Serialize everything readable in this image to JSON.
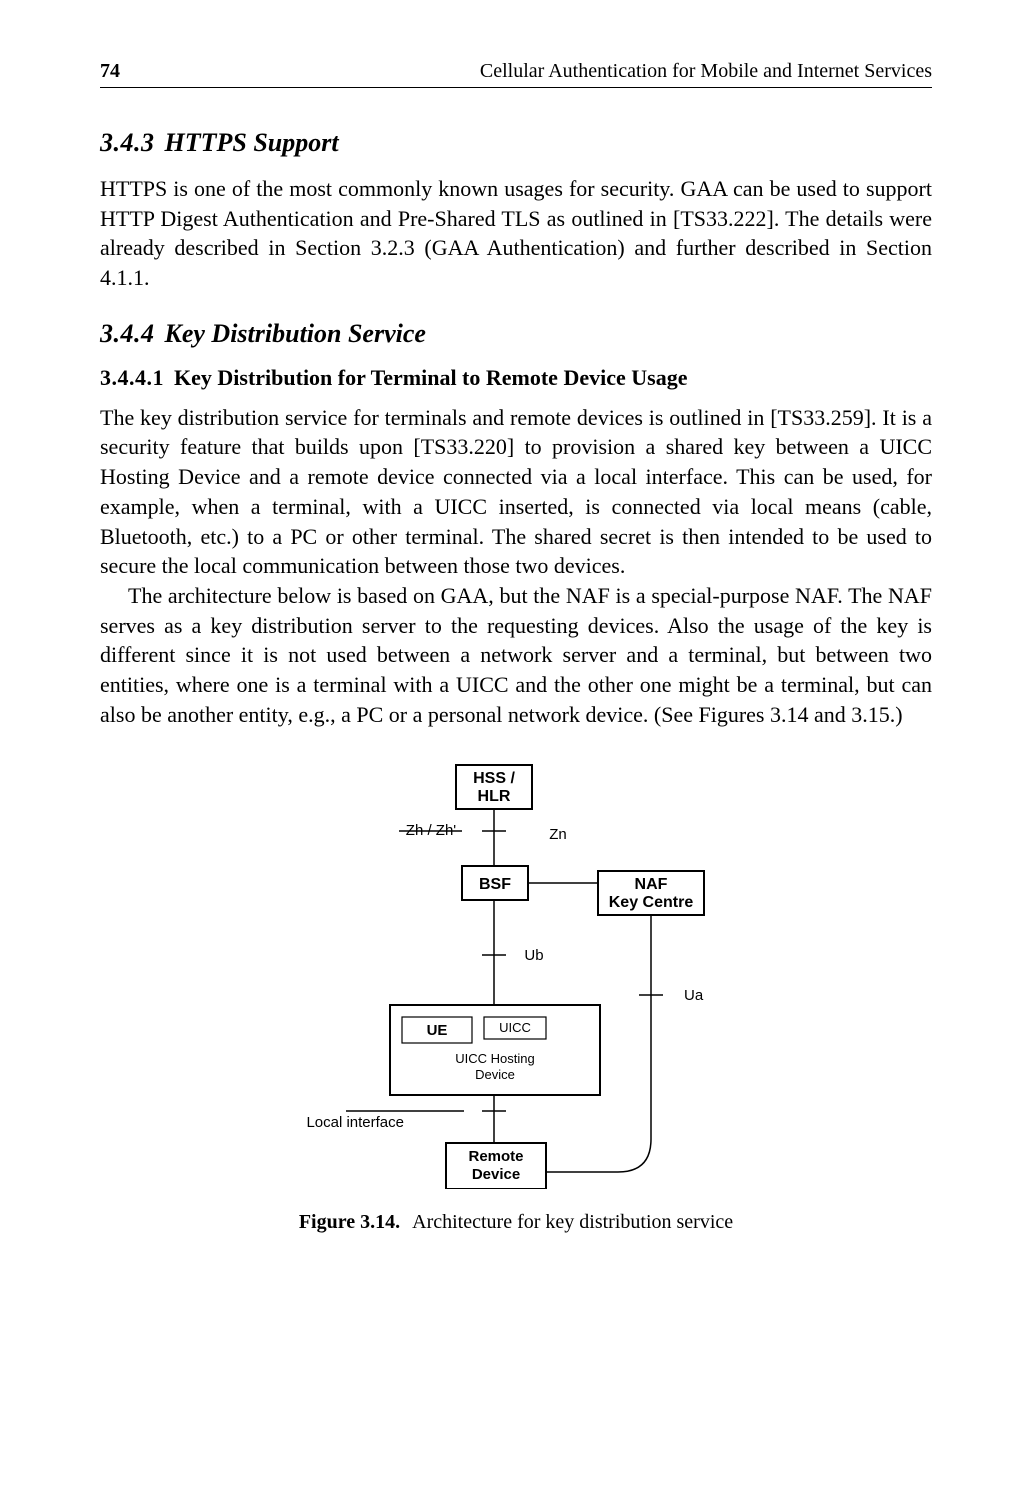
{
  "header": {
    "page_number": "74",
    "running_title": "Cellular Authentication for Mobile and Internet Services"
  },
  "section_343": {
    "number": "3.4.3",
    "title": "HTTPS Support",
    "paragraph": "HTTPS is one of the most commonly known usages for security. GAA can be used to support HTTP Digest Authentication and Pre-Shared TLS as outlined in [TS33.222]. The details were already described in Section 3.2.3 (GAA Authentication) and further described in Section 4.1.1."
  },
  "section_344": {
    "number": "3.4.4",
    "title": "Key Distribution Service",
    "sub_number": "3.4.4.1",
    "sub_title": "Key Distribution for Terminal to Remote Device Usage",
    "p1": "The key distribution service for terminals and remote devices is outlined in [TS33.259]. It is a security feature that builds upon [TS33.220] to provision a shared key between a UICC Hosting Device and a remote device connected via a local interface. This can be used, for example, when a terminal, with a UICC inserted, is connected via local means (cable, Bluetooth, etc.) to a PC or other terminal. The shared secret is then intended to be used to secure the local communication between those two devices.",
    "p2": "The architecture below is based on GAA, but the NAF is a special-purpose NAF. The NAF serves as a key distribution server to the requesting devices. Also the usage of the key is different since it is not used between a network server and a terminal, but between two entities, where one is a terminal with a UICC and the other one might be a terminal, but can also be another entity, e.g., a PC or a personal network device. (See Figures 3.14 and 3.15.)"
  },
  "figure": {
    "label": "Figure 3.14.",
    "caption": "Architecture for key distribution service",
    "nodes": {
      "hss": "HSS / HLR",
      "bsf": "BSF",
      "naf": "NAF Key Centre",
      "ue": "UE",
      "uicc": "UICC",
      "uicc_host": "UICC Hosting Device",
      "remote": "Remote Device"
    },
    "edges": {
      "zh": "Zh / Zh'",
      "zn": "Zn",
      "ub": "Ub",
      "ua": "Ua",
      "local": "Local interface"
    }
  }
}
